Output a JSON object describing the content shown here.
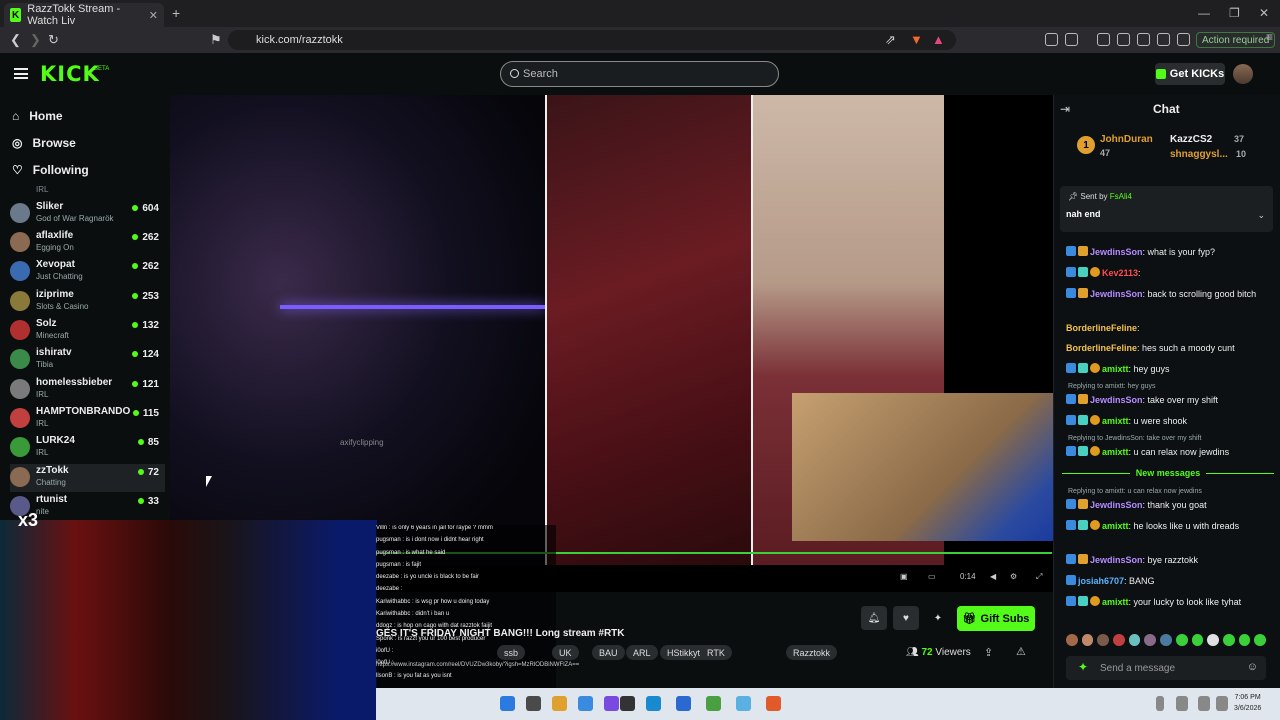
{
  "browser": {
    "tab_title": "RazzTokk Stream - Watch Liv",
    "url": "kick.com/razztokk",
    "action_required": "Action required"
  },
  "header": {
    "logo": "KICK",
    "beta": "BETA",
    "search_placeholder": "Search",
    "get_kicks": "Get KICKs"
  },
  "sidebar": {
    "nav": [
      "Home",
      "Browse",
      "Following"
    ],
    "channels": [
      {
        "name": "Sliker",
        "category": "God of War Ragnarök",
        "viewers": "604",
        "color": "#6a7a8a"
      },
      {
        "name": "aflaxlife",
        "category": "Egging On",
        "viewers": "262",
        "color": "#8a6a52"
      },
      {
        "name": "Xevopat",
        "category": "Just Chatting",
        "viewers": "262",
        "color": "#3a6ab0"
      },
      {
        "name": "iziprime",
        "category": "Slots & Casino",
        "viewers": "253",
        "color": "#8a7a3a"
      },
      {
        "name": "Solz",
        "category": "Minecraft",
        "viewers": "132",
        "color": "#b03030"
      },
      {
        "name": "ishiratv",
        "category": "Tibia",
        "viewers": "124",
        "color": "#3a8a4a"
      },
      {
        "name": "homelessbieber",
        "category": "IRL",
        "viewers": "121",
        "color": "#7a7a7a"
      },
      {
        "name": "HAMPTONBRANDO",
        "category": "IRL",
        "viewers": "115",
        "color": "#c04040"
      },
      {
        "name": "LURK24",
        "category": "IRL",
        "viewers": "85",
        "color": "#3a9a3a"
      },
      {
        "name": "zzTokk",
        "category": "Chatting",
        "viewers": "72",
        "color": "#8a6a52"
      },
      {
        "name": "rtunist",
        "category": "nite",
        "viewers": "33",
        "color": "#5a5a8a"
      }
    ],
    "irl_partial": "IRL"
  },
  "video": {
    "watermark": "axifyclipping",
    "webcam_label": "x3",
    "overlay_chat": [
      "Villn : is only 6 years in jail for raype ? mmm",
      "pugsman : is i dont now i didnt hear right",
      "pugsman : is what he said",
      "pugsman : is fajit",
      "deezabe : is yo uncle is black to be fair",
      "deezabe :",
      "Kariwithabbc : is wsg pr how u doing today",
      "Kariwithabbc : didn't i ban u",
      "ddogz : is hop on cago with dat razztok faijit",
      "Sponk : is razzt you ur 100 best producer",
      "i0ofU :",
      "i0ofU :",
      "llsonB : is you fat as you isnt"
    ],
    "time": "0:14"
  },
  "stream": {
    "title": "GES IT'S FRIDAY NIGHT BANG!!! Long stream #RTK",
    "link": "https://www.instagram.com/reel/DVUZDw3koby/?igsh=MzRlODBiNWFlZA==",
    "tags": [
      "ssb",
      "UK",
      "BAU",
      "ARL",
      "HStikkytokky",
      "RTK",
      "Razztokk"
    ],
    "viewers": "72",
    "viewers_label": "Viewers",
    "gift_subs": "Gift Subs"
  },
  "chat": {
    "title": "Chat",
    "leaderboard": [
      {
        "name": "JohnDuran",
        "count": "47"
      },
      {
        "name": "KazzCS2",
        "count": "37"
      },
      {
        "name": "shnaggysl...",
        "count": "10"
      }
    ],
    "pinned": {
      "sent_by_label": "Sent by",
      "sender": "FsAli4",
      "text": "nah end"
    },
    "messages": [
      {
        "user": "JewdinsSon",
        "text": "what is your fyp?",
        "color": "#b58cff"
      },
      {
        "user": "Kev2113",
        "text": "",
        "color": "#ff4d4d"
      },
      {
        "user": "JewdinsSon",
        "text": "back to scrolling good bitch",
        "color": "#b58cff"
      },
      {
        "user": "BorderlineFeline",
        "text": "",
        "color": "#f2c14e"
      },
      {
        "user": "BorderlineFeline",
        "text": "hes such a moody cunt",
        "color": "#f2c14e"
      },
      {
        "user": "amixtt",
        "text": "hey guys",
        "color": "#53fc18"
      },
      {
        "user": "JewdinsSon",
        "text": "take over my shift",
        "color": "#b58cff"
      },
      {
        "user": "amixtt",
        "text": "u were shook",
        "color": "#53fc18"
      },
      {
        "user": "amixtt",
        "text": "u can relax now jewdins",
        "color": "#53fc18"
      },
      {
        "user": "JewdinsSon",
        "text": "thank you goat",
        "color": "#b58cff"
      },
      {
        "user": "amixtt",
        "text": "he looks like u with dreads",
        "color": "#53fc18"
      },
      {
        "user": "JewdinsSon",
        "text": "bye razztokk",
        "color": "#b58cff"
      },
      {
        "user": "josiah6707",
        "text": "BANG",
        "color": "#5ab4ff"
      },
      {
        "user": "amixtt",
        "text": "your lucky to look like tyhat",
        "color": "#53fc18"
      }
    ],
    "replies": [
      "Replying to amixtt: hey guys",
      "Replying to JewdinsSon: take over my shift",
      "Replying to amixtt: u can relax now jewdins"
    ],
    "new_messages": "New messages",
    "send_placeholder": "Send a message"
  },
  "taskbar": {
    "time": "7:06 PM",
    "date": "3/6/2026"
  },
  "colors": {
    "accent": "#53fc18",
    "background": "#0b0e0f"
  }
}
